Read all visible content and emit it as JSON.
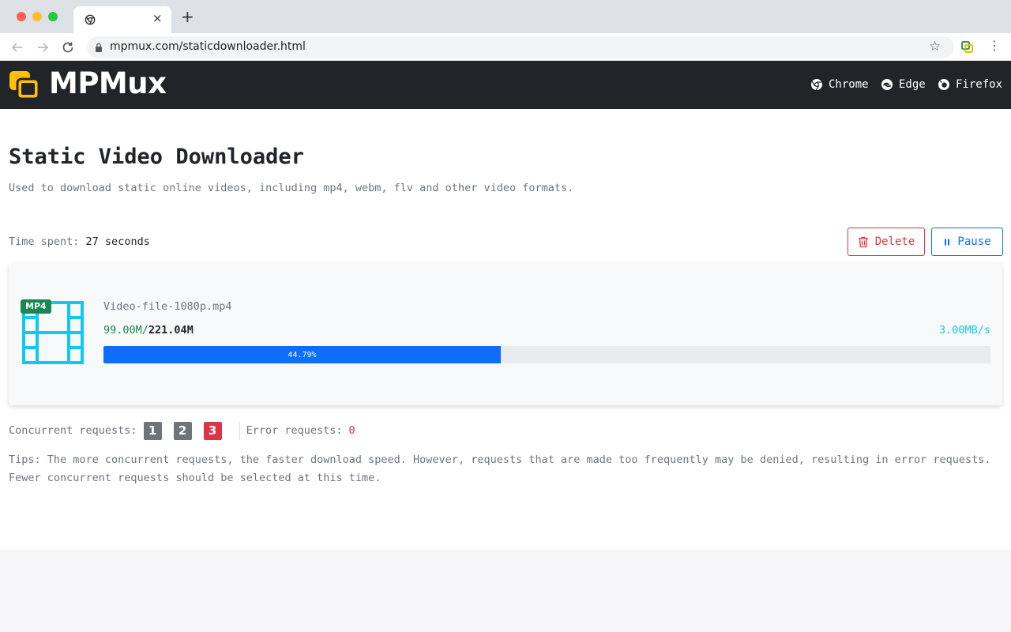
{
  "browser": {
    "url": "mpmux.com/staticdownloader.html",
    "tab_close": "×",
    "new_tab": "+"
  },
  "site": {
    "logo": "MPMux",
    "nav": [
      {
        "label": "Chrome",
        "icon": "chrome-icon"
      },
      {
        "label": "Edge",
        "icon": "edge-icon"
      },
      {
        "label": "Firefox",
        "icon": "firefox-icon"
      }
    ]
  },
  "page": {
    "title": "Static Video Downloader",
    "subtitle": "Used to download static online videos, including mp4, webm, flv and other video formats."
  },
  "status": {
    "time_label": "Time spent: ",
    "time_value": "27 seconds"
  },
  "actions": {
    "delete_label": "Delete",
    "pause_label": "Pause"
  },
  "download": {
    "badge": "MP4",
    "file_name": "Video-file-1080p.mp4",
    "downloaded": "99.00M",
    "separator": "/",
    "total": "221.04M",
    "speed": "3.00MB/s",
    "progress_label": "44.79%",
    "progress_percent": 44.79
  },
  "requests": {
    "concurrent_label": "Concurrent requests:",
    "options": [
      "1",
      "2",
      "3"
    ],
    "selected": "3",
    "error_label": "Error requests:",
    "error_count": "0"
  },
  "tips": "Tips: The more concurrent requests, the faster download speed. However, requests that are made too frequently may be denied, resulting in error requests. Fewer concurrent requests should be selected at this time.",
  "colors": {
    "header_bg": "#212529",
    "logo_yellow": "#ffc107",
    "danger": "#dc3545",
    "primary": "#0d6efd",
    "success": "#198754",
    "info": "#0dcaf0"
  }
}
